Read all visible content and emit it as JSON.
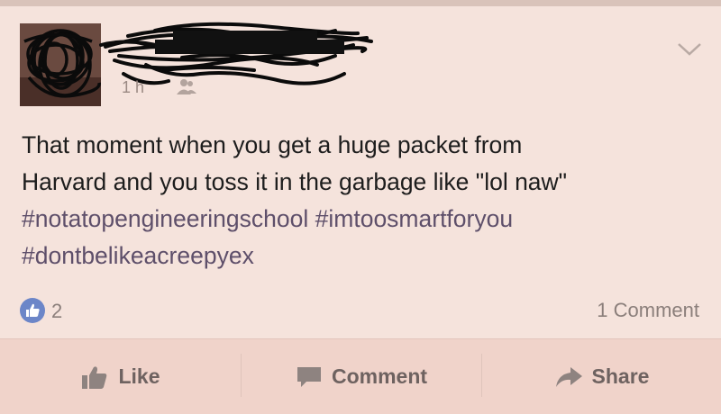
{
  "post": {
    "timestamp": "1 h",
    "text_line1": "That moment when you get a huge packet from",
    "text_line2": "Harvard and you toss it in the garbage like \"lol naw\"",
    "hashtag1": "#notatopengineeringschool",
    "hashtag2": "#imtoosmartforyou",
    "hashtag3": "#dontbelikeacreepyex"
  },
  "reactions": {
    "like_count": "2",
    "comment_count": "1 Comment"
  },
  "actions": {
    "like_label": "Like",
    "comment_label": "Comment",
    "share_label": "Share"
  },
  "colors": {
    "background": "#f2dcd3",
    "like_badge": "#6c86c8",
    "hashtag": "#5e4f6a"
  }
}
